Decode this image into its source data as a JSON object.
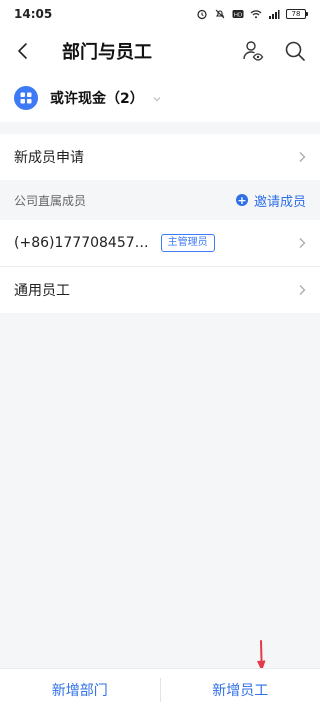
{
  "status_bar": {
    "time": "14:05",
    "icons": [
      "alarm-icon",
      "mute-icon",
      "hd-icon",
      "wifi-icon",
      "signal-icon"
    ],
    "battery": "78"
  },
  "header": {
    "title": "部门与员工",
    "actions": [
      "member-visibility-icon",
      "search-icon"
    ]
  },
  "org": {
    "name": "或许现金（2）"
  },
  "rows": {
    "new_member_request": "新成员申请"
  },
  "section": {
    "title": "公司直属成员",
    "invite_label": "邀请成员"
  },
  "members": [
    {
      "phone": "(+86)177708457…",
      "role": "主管理员"
    }
  ],
  "general_staff": "通用员工",
  "bottom_bar": {
    "add_department": "新增部门",
    "add_employee": "新增员工"
  },
  "colors": {
    "accent": "#2f6fe8",
    "logo": "#3d7af5",
    "annotation_arrow": "#e23b4a"
  }
}
